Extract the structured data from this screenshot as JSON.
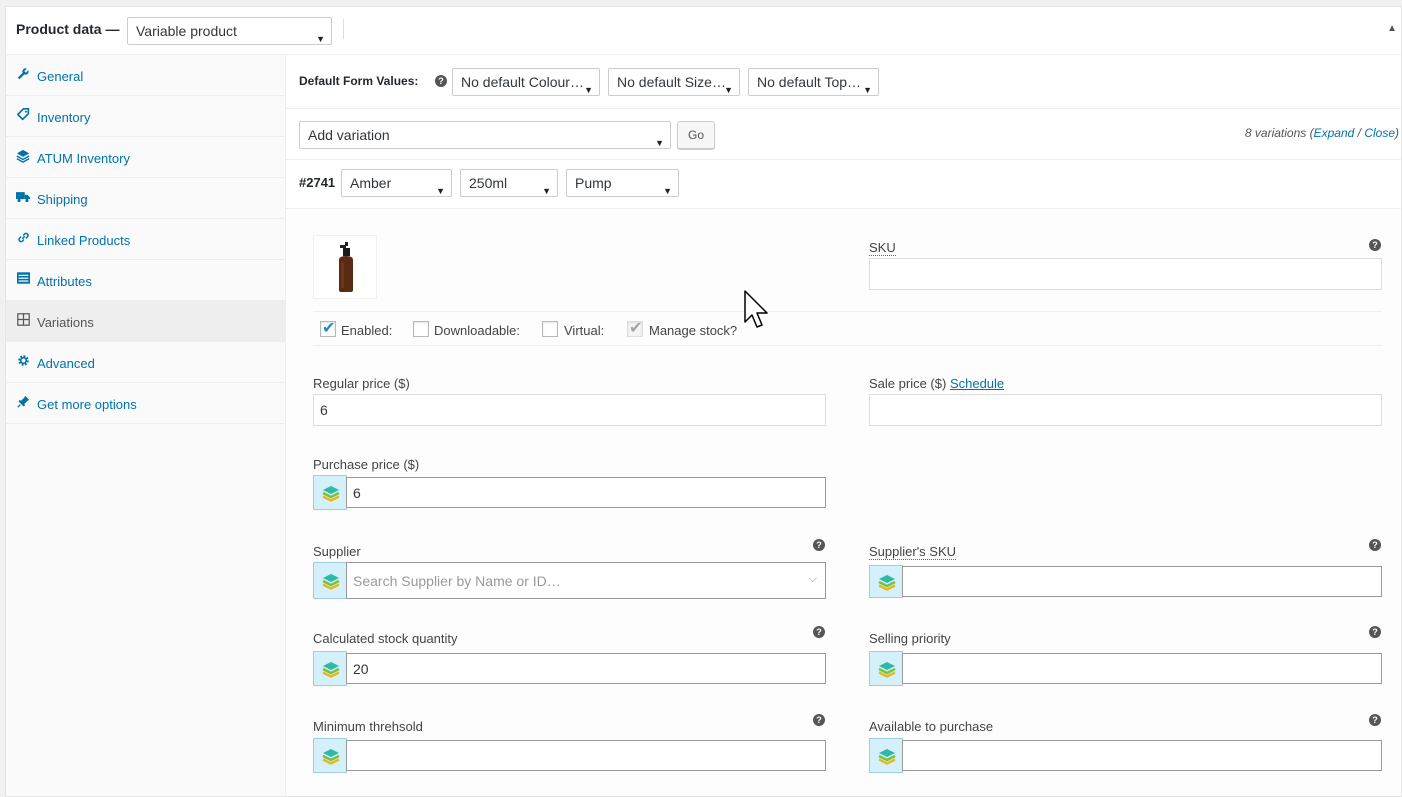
{
  "header": {
    "title": "Product data —",
    "product_type": "Variable product"
  },
  "tabs": [
    {
      "label": "General",
      "icon": "wrench-icon"
    },
    {
      "label": "Inventory",
      "icon": "tag-icon"
    },
    {
      "label": "ATUM Inventory",
      "icon": "layers-icon"
    },
    {
      "label": "Shipping",
      "icon": "truck-icon"
    },
    {
      "label": "Linked Products",
      "icon": "link-icon"
    },
    {
      "label": "Attributes",
      "icon": "list-icon"
    },
    {
      "label": "Variations",
      "icon": "grid-icon"
    },
    {
      "label": "Advanced",
      "icon": "gear-icon"
    },
    {
      "label": "Get more options",
      "icon": "plugin-icon"
    }
  ],
  "defaults": {
    "label": "Default Form Values:",
    "colour": "No default Colour…",
    "size": "No default Size…",
    "top": "No default Top…"
  },
  "add_variation": {
    "select": "Add variation",
    "go": "Go",
    "count_prefix": "8 variations (",
    "expand": "Expand",
    "slash": " / ",
    "close": "Close",
    "count_suffix": ")"
  },
  "variation": {
    "id": "#2741",
    "colour": "Amber",
    "size": "250ml",
    "top": "Pump"
  },
  "form": {
    "sku_label": "SKU",
    "sku_value": "",
    "enabled": "Enabled:",
    "downloadable": "Downloadable:",
    "virtual": "Virtual:",
    "manage_stock": "Manage stock?",
    "regular_price_label": "Regular price ($)",
    "regular_price": "6",
    "sale_price_label": "Sale price ($)",
    "schedule": "Schedule",
    "purchase_price_label": "Purchase price ($)",
    "purchase_price": "6",
    "supplier_label": "Supplier",
    "supplier_placeholder": "Search Supplier by Name or ID…",
    "supplier_sku_label": "Supplier's SKU",
    "calc_stock_label": "Calculated stock quantity",
    "calc_stock": "20",
    "selling_priority_label": "Selling priority",
    "min_threshold_label": "Minimum threhsold",
    "available_label": "Available to purchase"
  },
  "colors": {
    "link": "#0073aa",
    "atum_bg": "#d4f1fb",
    "checkbox": "#1e8cbe"
  }
}
